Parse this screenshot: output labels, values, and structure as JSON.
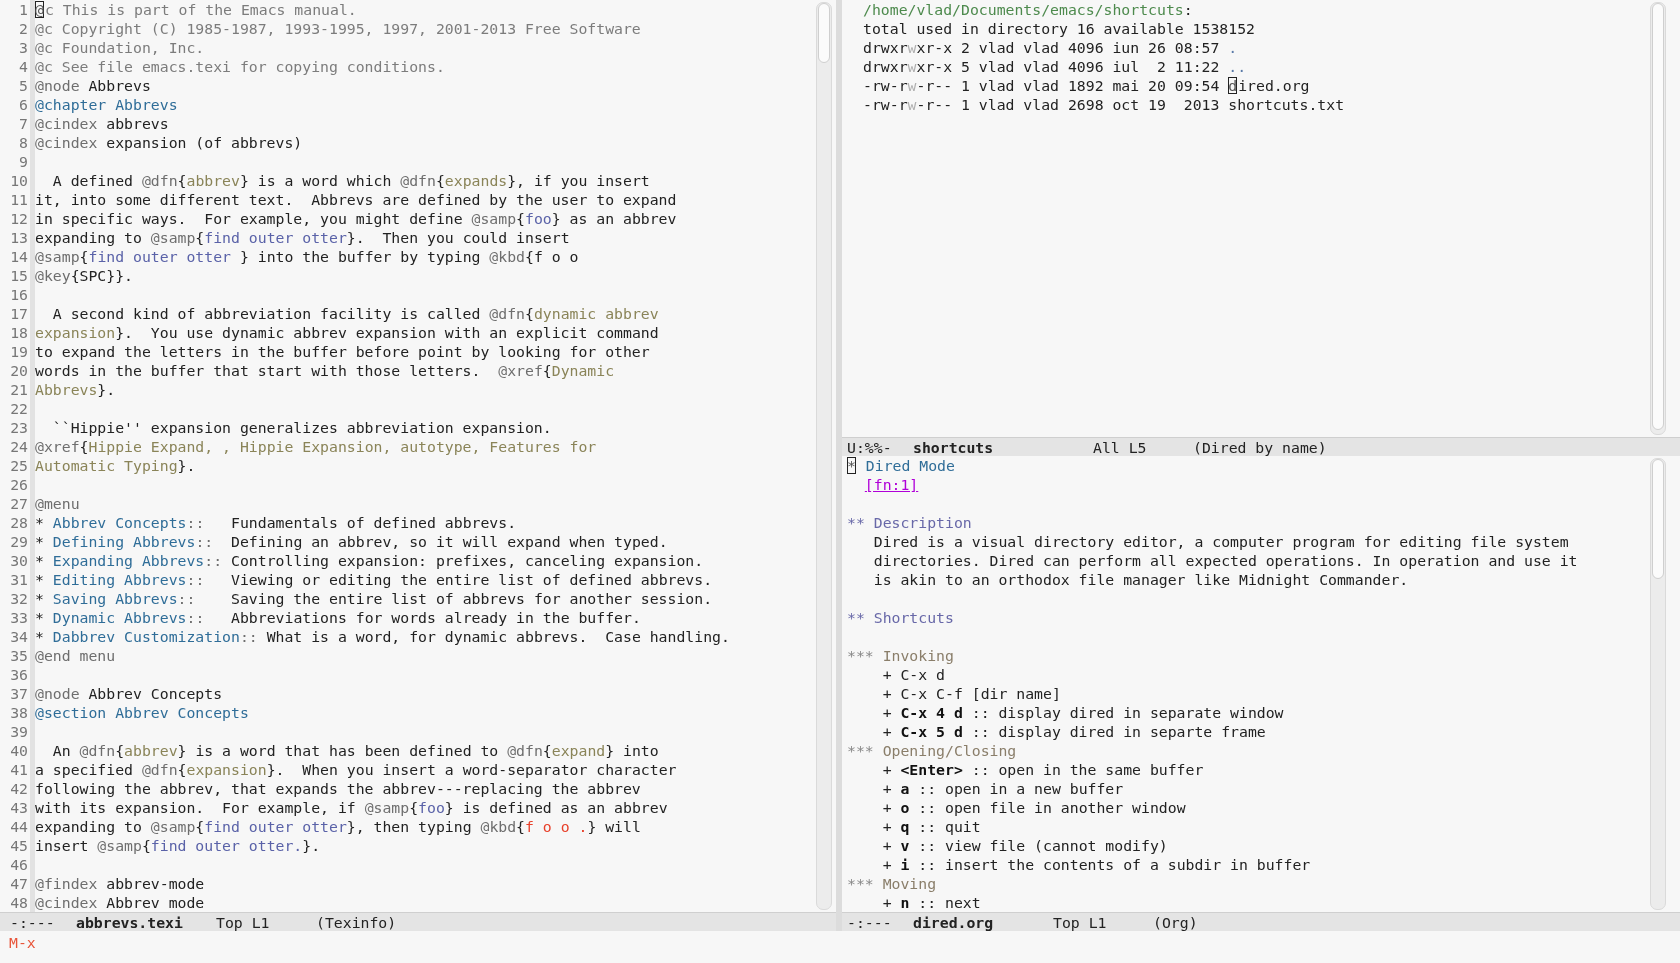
{
  "windows": [
    {
      "kind": "source",
      "lines": [
        {
          "number": "1",
          "segments": [
            {
              "kind": "cursor",
              "text": "@"
            },
            {
              "kind": "comment",
              "text": "c This is part of the Emacs manual."
            }
          ]
        },
        {
          "number": "2",
          "segments": [
            {
              "kind": "comment",
              "text": "@c Copyright (C) 1985-1987, 1993-1995, 1997, 2001-2013 Free Software"
            }
          ]
        },
        {
          "number": "3",
          "segments": [
            {
              "kind": "comment",
              "text": "@c Foundation, Inc."
            }
          ]
        },
        {
          "number": "4",
          "segments": [
            {
              "kind": "comment",
              "text": "@c See file emacs.texi for copying conditions."
            }
          ]
        },
        {
          "number": "5",
          "segments": [
            {
              "kind": "command",
              "text": "@node"
            },
            {
              "kind": "plain",
              "text": " Abbrevs"
            }
          ]
        },
        {
          "number": "6",
          "segments": [
            {
              "kind": "heading",
              "text": "@chapter Abbrevs"
            }
          ]
        },
        {
          "number": "7",
          "segments": [
            {
              "kind": "command",
              "text": "@cindex"
            },
            {
              "kind": "plain",
              "text": " abbrevs"
            }
          ]
        },
        {
          "number": "8",
          "segments": [
            {
              "kind": "command",
              "text": "@cindex"
            },
            {
              "kind": "plain",
              "text": " expansion (of abbrevs)"
            }
          ]
        },
        {
          "number": "9"
        },
        {
          "number": "10",
          "segments": [
            {
              "kind": "plain",
              "text": "  A defined "
            },
            {
              "kind": "command",
              "text": "@dfn"
            },
            {
              "kind": "plain",
              "text": "{"
            },
            {
              "kind": "argument",
              "text": "abbrev"
            },
            {
              "kind": "plain",
              "text": "} is a word which "
            },
            {
              "kind": "command",
              "text": "@dfn"
            },
            {
              "kind": "plain",
              "text": "{"
            },
            {
              "kind": "argument",
              "text": "expands"
            },
            {
              "kind": "plain",
              "text": "}, if you insert"
            }
          ]
        },
        {
          "number": "11",
          "segments": [
            {
              "kind": "plain",
              "text": "it, into some different text.  Abbrevs are defined by the user to expand"
            }
          ]
        },
        {
          "number": "12",
          "segments": [
            {
              "kind": "plain",
              "text": "in specific ways.  For example, you might define "
            },
            {
              "kind": "command",
              "text": "@samp"
            },
            {
              "kind": "plain",
              "text": "{"
            },
            {
              "kind": "sample",
              "text": "foo"
            },
            {
              "kind": "plain",
              "text": "} as an abbrev"
            }
          ]
        },
        {
          "number": "13",
          "segments": [
            {
              "kind": "plain",
              "text": "expanding to "
            },
            {
              "kind": "command",
              "text": "@samp"
            },
            {
              "kind": "plain",
              "text": "{"
            },
            {
              "kind": "sample",
              "text": "find outer otter"
            },
            {
              "kind": "plain",
              "text": "}.  Then you could insert"
            }
          ]
        },
        {
          "number": "14",
          "segments": [
            {
              "kind": "command",
              "text": "@samp"
            },
            {
              "kind": "plain",
              "text": "{"
            },
            {
              "kind": "sample",
              "text": "find outer otter "
            },
            {
              "kind": "plain",
              "text": "} into the buffer by typing "
            },
            {
              "kind": "command",
              "text": "@kbd"
            },
            {
              "kind": "plain",
              "text": "{f o o"
            }
          ]
        },
        {
          "number": "15",
          "segments": [
            {
              "kind": "command",
              "text": "@key"
            },
            {
              "kind": "plain",
              "text": "{SPC}}."
            }
          ]
        },
        {
          "number": "16"
        },
        {
          "number": "17",
          "segments": [
            {
              "kind": "plain",
              "text": "  A second kind of abbreviation facility is called "
            },
            {
              "kind": "command",
              "text": "@dfn"
            },
            {
              "kind": "plain",
              "text": "{"
            },
            {
              "kind": "argument",
              "text": "dynamic abbrev"
            }
          ]
        },
        {
          "number": "18",
          "segments": [
            {
              "kind": "argument",
              "text": "expansion"
            },
            {
              "kind": "plain",
              "text": "}.  You use dynamic abbrev expansion with an explicit command"
            }
          ]
        },
        {
          "number": "19",
          "segments": [
            {
              "kind": "plain",
              "text": "to expand the letters in the buffer before point by looking for other"
            }
          ]
        },
        {
          "number": "20",
          "segments": [
            {
              "kind": "plain",
              "text": "words in the buffer that start with those letters.  "
            },
            {
              "kind": "command",
              "text": "@xref"
            },
            {
              "kind": "plain",
              "text": "{"
            },
            {
              "kind": "argument",
              "text": "Dynamic"
            }
          ]
        },
        {
          "number": "21",
          "segments": [
            {
              "kind": "argument",
              "text": "Abbrevs"
            },
            {
              "kind": "plain",
              "text": "}."
            }
          ]
        },
        {
          "number": "22"
        },
        {
          "number": "23",
          "segments": [
            {
              "kind": "plain",
              "text": "  ``Hippie'' expansion generalizes abbreviation expansion."
            }
          ]
        },
        {
          "number": "24",
          "segments": [
            {
              "kind": "command",
              "text": "@xref"
            },
            {
              "kind": "plain",
              "text": "{"
            },
            {
              "kind": "argument",
              "text": "Hippie Expand, , Hippie Expansion, autotype, Features for"
            }
          ]
        },
        {
          "number": "25",
          "segments": [
            {
              "kind": "argument",
              "text": "Automatic Typing"
            },
            {
              "kind": "plain",
              "text": "}."
            }
          ]
        },
        {
          "number": "26"
        },
        {
          "number": "27",
          "segments": [
            {
              "kind": "command",
              "text": "@menu"
            }
          ]
        },
        {
          "number": "28",
          "segments": [
            {
              "kind": "plain",
              "text": "* "
            },
            {
              "kind": "link",
              "text": "Abbrev Concepts"
            },
            {
              "kind": "command",
              "text": "::"
            },
            {
              "kind": "plain",
              "text": "   Fundamentals of defined abbrevs."
            }
          ]
        },
        {
          "number": "29",
          "segments": [
            {
              "kind": "plain",
              "text": "* "
            },
            {
              "kind": "link",
              "text": "Defining Abbrevs"
            },
            {
              "kind": "command",
              "text": "::"
            },
            {
              "kind": "plain",
              "text": "  Defining an abbrev, so it will expand when typed."
            }
          ]
        },
        {
          "number": "30",
          "segments": [
            {
              "kind": "plain",
              "text": "* "
            },
            {
              "kind": "link",
              "text": "Expanding Abbrevs"
            },
            {
              "kind": "command",
              "text": "::"
            },
            {
              "kind": "plain",
              "text": " Controlling expansion: prefixes, canceling expansion."
            }
          ]
        },
        {
          "number": "31",
          "segments": [
            {
              "kind": "plain",
              "text": "* "
            },
            {
              "kind": "link",
              "text": "Editing Abbrevs"
            },
            {
              "kind": "command",
              "text": "::"
            },
            {
              "kind": "plain",
              "text": "   Viewing or editing the entire list of defined abbrevs."
            }
          ]
        },
        {
          "number": "32",
          "segments": [
            {
              "kind": "plain",
              "text": "* "
            },
            {
              "kind": "link",
              "text": "Saving Abbrevs"
            },
            {
              "kind": "command",
              "text": "::"
            },
            {
              "kind": "plain",
              "text": "    Saving the entire list of abbrevs for another session."
            }
          ]
        },
        {
          "number": "33",
          "segments": [
            {
              "kind": "plain",
              "text": "* "
            },
            {
              "kind": "link",
              "text": "Dynamic Abbrevs"
            },
            {
              "kind": "command",
              "text": "::"
            },
            {
              "kind": "plain",
              "text": "   Abbreviations for words already in the buffer."
            }
          ]
        },
        {
          "number": "34",
          "segments": [
            {
              "kind": "plain",
              "text": "* "
            },
            {
              "kind": "link",
              "text": "Dabbrev Customization"
            },
            {
              "kind": "command",
              "text": "::"
            },
            {
              "kind": "plain",
              "text": " What is a word, for dynamic abbrevs.  Case handling."
            }
          ]
        },
        {
          "number": "35",
          "segments": [
            {
              "kind": "command",
              "text": "@end menu"
            }
          ]
        },
        {
          "number": "36"
        },
        {
          "number": "37",
          "segments": [
            {
              "kind": "command",
              "text": "@node"
            },
            {
              "kind": "plain",
              "text": " Abbrev Concepts"
            }
          ]
        },
        {
          "number": "38",
          "segments": [
            {
              "kind": "heading",
              "text": "@section Abbrev Concepts"
            }
          ]
        },
        {
          "number": "39"
        },
        {
          "number": "40",
          "segments": [
            {
              "kind": "plain",
              "text": "  An "
            },
            {
              "kind": "command",
              "text": "@dfn"
            },
            {
              "kind": "plain",
              "text": "{"
            },
            {
              "kind": "argument",
              "text": "abbrev"
            },
            {
              "kind": "plain",
              "text": "} is a word that has been defined to "
            },
            {
              "kind": "command",
              "text": "@dfn"
            },
            {
              "kind": "plain",
              "text": "{"
            },
            {
              "kind": "argument",
              "text": "expand"
            },
            {
              "kind": "plain",
              "text": "} into"
            }
          ]
        },
        {
          "number": "41",
          "segments": [
            {
              "kind": "plain",
              "text": "a specified "
            },
            {
              "kind": "command",
              "text": "@dfn"
            },
            {
              "kind": "plain",
              "text": "{"
            },
            {
              "kind": "argument",
              "text": "expansion"
            },
            {
              "kind": "plain",
              "text": "}.  When you insert a word-separator character"
            }
          ]
        },
        {
          "number": "42",
          "segments": [
            {
              "kind": "plain",
              "text": "following the abbrev, that expands the abbrev---replacing the abbrev"
            }
          ]
        },
        {
          "number": "43",
          "segments": [
            {
              "kind": "plain",
              "text": "with its expansion.  For example, if "
            },
            {
              "kind": "command",
              "text": "@samp"
            },
            {
              "kind": "plain",
              "text": "{"
            },
            {
              "kind": "sample",
              "text": "foo"
            },
            {
              "kind": "plain",
              "text": "} is defined as an abbrev"
            }
          ]
        },
        {
          "number": "44",
          "segments": [
            {
              "kind": "plain",
              "text": "expanding to "
            },
            {
              "kind": "command",
              "text": "@samp"
            },
            {
              "kind": "plain",
              "text": "{"
            },
            {
              "kind": "sample",
              "text": "find outer otter"
            },
            {
              "kind": "plain",
              "text": "}, then typing "
            },
            {
              "kind": "command",
              "text": "@kbd"
            },
            {
              "kind": "plain",
              "text": "{"
            },
            {
              "kind": "key",
              "text": "f o o ."
            },
            {
              "kind": "plain",
              "text": "} will"
            }
          ]
        },
        {
          "number": "45",
          "segments": [
            {
              "kind": "plain",
              "text": "insert "
            },
            {
              "kind": "command",
              "text": "@samp"
            },
            {
              "kind": "plain",
              "text": "{"
            },
            {
              "kind": "sample",
              "text": "find outer otter."
            },
            {
              "kind": "plain",
              "text": "}."
            }
          ]
        },
        {
          "number": "46"
        },
        {
          "number": "47",
          "segments": [
            {
              "kind": "command",
              "text": "@findex"
            },
            {
              "kind": "plain",
              "text": " abbrev-mode"
            }
          ]
        },
        {
          "number": "48",
          "segments": [
            {
              "kind": "command",
              "text": "@cindex"
            },
            {
              "kind": "plain",
              "text": " Abbrev mode"
            }
          ]
        }
      ],
      "mode_line": {
        "status": "-:---",
        "buffer": "abbrevs.texi",
        "position": "Top L1",
        "mode": "(Texinfo)"
      }
    },
    {
      "kind": "dired",
      "lines": [
        {
          "segments": [
            {
              "kind": "path",
              "text": "/home/vlad/Documents/emacs/shortcuts"
            },
            {
              "kind": "plain",
              "text": ":"
            }
          ]
        },
        {
          "segments": [
            {
              "kind": "plain",
              "text": "total used in directory 16 available 1538152"
            }
          ]
        },
        {
          "segments": [
            {
              "kind": "plain",
              "text": "drwxr"
            },
            {
              "kind": "faded",
              "text": "w"
            },
            {
              "kind": "plain",
              "text": "xr-x 2 vlad vlad 4096 iun 26 08:57 "
            },
            {
              "kind": "dir",
              "text": "."
            }
          ]
        },
        {
          "segments": [
            {
              "kind": "plain",
              "text": "drwxr"
            },
            {
              "kind": "faded",
              "text": "w"
            },
            {
              "kind": "plain",
              "text": "xr-x 5 vlad vlad 4096 iul  2 11:22 "
            },
            {
              "kind": "dir",
              "text": ".."
            }
          ]
        },
        {
          "segments": [
            {
              "kind": "plain",
              "text": "-rw-r"
            },
            {
              "kind": "faded",
              "text": "w"
            },
            {
              "kind": "plain",
              "text": "-r-- 1 vlad vlad 1892 mai 20 09:54 "
            },
            {
              "kind": "cursor",
              "text": "d"
            },
            {
              "kind": "plain",
              "text": "ired.org"
            }
          ]
        },
        {
          "segments": [
            {
              "kind": "plain",
              "text": "-rw-r"
            },
            {
              "kind": "faded",
              "text": "w"
            },
            {
              "kind": "plain",
              "text": "-r-- 1 vlad vlad 2698 oct 19  2013 shortcuts.txt"
            }
          ]
        }
      ],
      "mode_line": {
        "status": "U:%%-",
        "buffer": "shortcuts",
        "position": "All L5",
        "mode": "(Dired by name)"
      }
    },
    {
      "kind": "org",
      "lines": [
        {
          "segments": [
            {
              "kind": "cursor",
              "text": "*"
            },
            {
              "kind": "title1",
              "text": " Dired Mode"
            }
          ]
        },
        {
          "segments": [
            {
              "kind": "footnote",
              "text": "[fn:1]"
            }
          ]
        },
        {
          "kind": "blank"
        },
        {
          "segments": [
            {
              "kind": "title2",
              "text": "** Description"
            }
          ]
        },
        {
          "segments": [
            {
              "kind": "plain",
              "text": "   Dired is a visual directory editor, a computer program for editing file system"
            }
          ]
        },
        {
          "segments": [
            {
              "kind": "plain",
              "text": "   directories. Dired can perform all expected operations. In operation and use it"
            }
          ]
        },
        {
          "segments": [
            {
              "kind": "plain",
              "text": "   is akin to an orthodox file manager like Midnight Commander."
            }
          ]
        },
        {
          "kind": "blank"
        },
        {
          "segments": [
            {
              "kind": "title2",
              "text": "** Shortcuts"
            }
          ]
        },
        {
          "kind": "blank"
        },
        {
          "segments": [
            {
              "kind": "stars",
              "text": "***"
            },
            {
              "kind": "title3",
              "text": " Invoking"
            }
          ]
        },
        {
          "segments": [
            {
              "kind": "plain",
              "text": "    + C-x d"
            }
          ]
        },
        {
          "segments": [
            {
              "kind": "plain",
              "text": "    + C-x C-f [dir name]"
            }
          ]
        },
        {
          "segments": [
            {
              "kind": "plain",
              "text": "    + "
            },
            {
              "kind": "bold",
              "text": "C-x 4 d"
            },
            {
              "kind": "plain",
              "text": " :: display dired in separate window"
            }
          ]
        },
        {
          "segments": [
            {
              "kind": "plain",
              "text": "    + "
            },
            {
              "kind": "bold",
              "text": "C-x 5 d"
            },
            {
              "kind": "plain",
              "text": " :: display dired in separte frame"
            }
          ]
        },
        {
          "segments": [
            {
              "kind": "stars",
              "text": "***"
            },
            {
              "kind": "title3",
              "text": " Opening/Closing"
            }
          ]
        },
        {
          "segments": [
            {
              "kind": "plain",
              "text": "    + "
            },
            {
              "kind": "bold",
              "text": "<Enter>"
            },
            {
              "kind": "plain",
              "text": " :: open in the same buffer"
            }
          ]
        },
        {
          "segments": [
            {
              "kind": "plain",
              "text": "    + "
            },
            {
              "kind": "bold",
              "text": "a"
            },
            {
              "kind": "plain",
              "text": " :: open in a new buffer"
            }
          ]
        },
        {
          "segments": [
            {
              "kind": "plain",
              "text": "    + "
            },
            {
              "kind": "bold",
              "text": "o"
            },
            {
              "kind": "plain",
              "text": " :: open file in another window"
            }
          ]
        },
        {
          "segments": [
            {
              "kind": "plain",
              "text": "    + "
            },
            {
              "kind": "bold",
              "text": "q"
            },
            {
              "kind": "plain",
              "text": " :: quit"
            }
          ]
        },
        {
          "segments": [
            {
              "kind": "plain",
              "text": "    + "
            },
            {
              "kind": "bold",
              "text": "v"
            },
            {
              "kind": "plain",
              "text": " :: view file (cannot modify)"
            }
          ]
        },
        {
          "segments": [
            {
              "kind": "plain",
              "text": "    + "
            },
            {
              "kind": "bold",
              "text": "i"
            },
            {
              "kind": "plain",
              "text": " :: insert the contents of a subdir in buffer"
            }
          ]
        },
        {
          "segments": [
            {
              "kind": "stars",
              "text": "***"
            },
            {
              "kind": "title3",
              "text": " Moving"
            }
          ]
        },
        {
          "segments": [
            {
              "kind": "plain",
              "text": "    + "
            },
            {
              "kind": "bold",
              "text": "n"
            },
            {
              "kind": "plain",
              "text": " :: next"
            }
          ]
        }
      ],
      "mode_line": {
        "status": "-:---",
        "buffer": "dired.org",
        "position": "Top L1",
        "mode": "(Org)"
      }
    }
  ],
  "minibuffer": {
    "prompt": "M-x"
  }
}
